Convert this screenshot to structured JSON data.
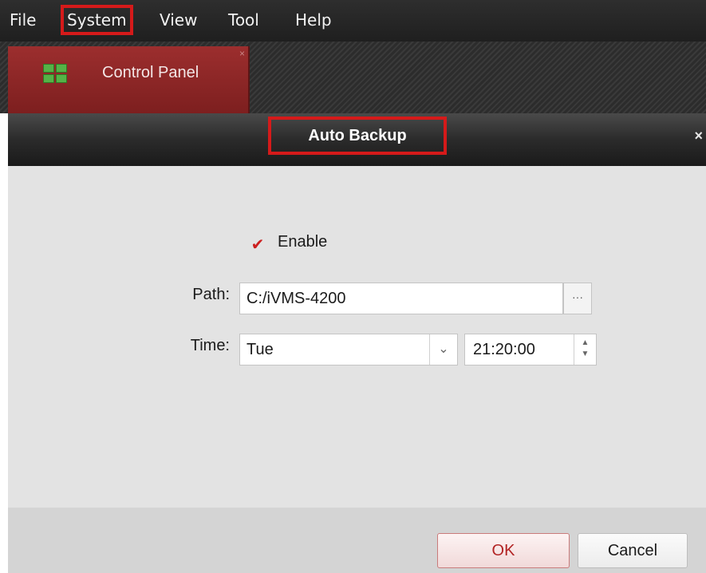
{
  "menubar": {
    "items": [
      {
        "label": "File"
      },
      {
        "label": "System"
      },
      {
        "label": "View"
      },
      {
        "label": "Tool"
      },
      {
        "label": "Help"
      }
    ]
  },
  "tab": {
    "label": "Control Panel",
    "icon": "grid-icon"
  },
  "dialog": {
    "title": "Auto Backup",
    "close_glyph": "×",
    "enable": {
      "label": "Enable",
      "checked": true
    },
    "path": {
      "label": "Path:",
      "value": "C:/iVMS-4200",
      "browse_label": "···"
    },
    "time": {
      "label": "Time:",
      "day": "Tue",
      "clock": "21:20:00"
    },
    "buttons": {
      "ok": "OK",
      "cancel": "Cancel"
    }
  },
  "colors": {
    "highlight": "#d51a1a",
    "tab_active": "#8a2525",
    "checkmark": "#cc1f1f"
  }
}
